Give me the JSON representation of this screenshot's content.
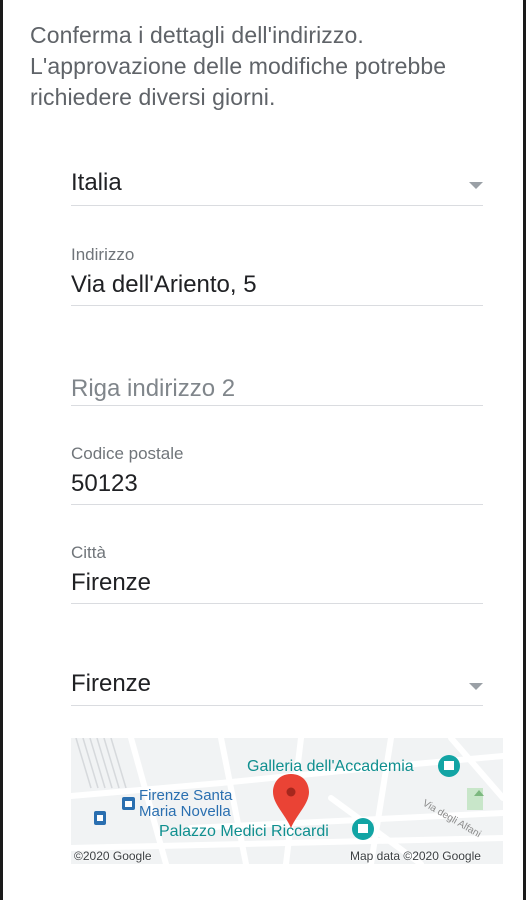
{
  "intro": {
    "line1": "Conferma i dettagli dell'indirizzo.",
    "line2": "L'approvazione delle modifiche potrebbe",
    "line3": "richiedere diversi giorni."
  },
  "form": {
    "country": {
      "value": "Italia"
    },
    "address": {
      "label": "Indirizzo",
      "value": "Via dell'Ariento, 5"
    },
    "address_line2": {
      "placeholder": "Riga indirizzo 2"
    },
    "postal_code": {
      "label": "Codice postale",
      "value": "50123"
    },
    "city": {
      "label": "Città",
      "value": "Firenze"
    },
    "province": {
      "value": "Firenze"
    }
  },
  "map": {
    "poi_accademia": "Galleria dell'Accademia",
    "poi_station_line1": "Firenze Santa",
    "poi_station_line2": "Maria Novella",
    "poi_riccardi": "Palazzo Medici Riccardi",
    "street_alfani": "Via degli Alfani",
    "copyright_left": "©2020 Google",
    "copyright_right": "Map data ©2020 Google",
    "marker_color": "#ea4335",
    "poi_color": "#12a4a4"
  }
}
